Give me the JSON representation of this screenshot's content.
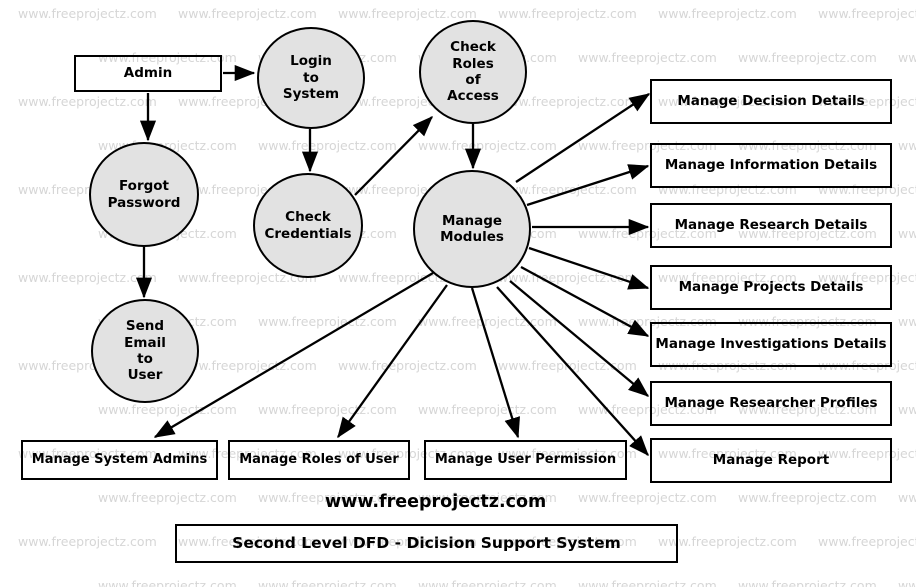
{
  "diagram": {
    "title": "Second Level DFD - Dicision Support System",
    "brand": "www.freeprojectz.com",
    "watermark_text": "www.freeprojectz.com",
    "colors": {
      "process_fill": "#e2e2e2",
      "stroke": "#000000",
      "watermark": "#d6d6d6",
      "background": "#ffffff"
    }
  },
  "nodes": {
    "admin": {
      "label": "Admin",
      "type": "external-entity"
    },
    "login_to_system": {
      "label": "Login\nto\nSystem",
      "line1": "Login",
      "line2": "to",
      "line3": "System",
      "type": "process"
    },
    "check_roles_of_access": {
      "line1": "Check",
      "line2": "Roles",
      "line3": "of",
      "line4": "Access",
      "type": "process"
    },
    "forgot_password": {
      "line1": "Forgot",
      "line2": "Password",
      "type": "process"
    },
    "check_credentials": {
      "line1": "Check",
      "line2": "Credentials",
      "type": "process"
    },
    "manage_modules": {
      "line1": "Manage",
      "line2": "Modules",
      "type": "process"
    },
    "send_email_to_user": {
      "line1": "Send",
      "line2": "Email",
      "line3": "to",
      "line4": "User",
      "type": "process"
    }
  },
  "data_stores_right": [
    {
      "label": "Manage Decision Details"
    },
    {
      "label": "Manage Information Details"
    },
    {
      "label": "Manage Research Details"
    },
    {
      "label": "Manage Projects Details"
    },
    {
      "label": "Manage Investigations Details"
    },
    {
      "label": "Manage Researcher Profiles"
    },
    {
      "label": "Manage Report"
    }
  ],
  "data_stores_bottom": [
    {
      "label": "Manage System Admins"
    },
    {
      "label": "Manage Roles of User"
    },
    {
      "label": "Manage User Permission"
    }
  ]
}
